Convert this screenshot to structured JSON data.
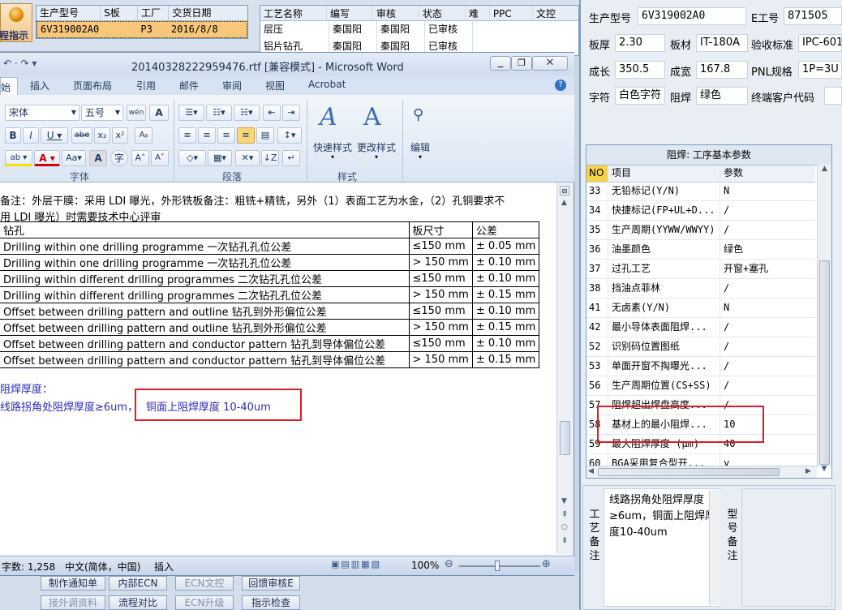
{
  "bg_app": {
    "logo_label": "程指示",
    "order_table": {
      "headers": [
        "生产型号",
        "S板",
        "工厂",
        "交货日期"
      ],
      "row": [
        "6V319002A0",
        "",
        "P3",
        "2016/8/8"
      ]
    },
    "process_table": {
      "headers": [
        "工艺名称",
        "编写",
        "审核",
        "状态",
        "难",
        "PPC",
        "文控"
      ],
      "rows": [
        [
          "层压",
          "秦国阳",
          "秦国阳",
          "已审核"
        ],
        [
          "铝片钻孔",
          "秦国阳",
          "秦国阳",
          "已审核"
        ]
      ]
    },
    "bottom_buttons": [
      "制作通知单",
      "内部ECN",
      "ECN文控",
      "回馈审核E",
      "接外调资料",
      "流程对比",
      "ECN升级",
      "指示检查"
    ]
  },
  "right_panel": {
    "fields": {
      "model_label": "生产型号",
      "model_value": "6V319002A0",
      "e_no_label": "E工号",
      "e_no_value": "871505",
      "thickness_label": "板厚",
      "thickness_value": "2.30",
      "material_label": "板材",
      "material_value": "IT-180A",
      "standard_label": "验收标准",
      "standard_value": "IPC-601",
      "length_label": "成长",
      "length_value": "350.5",
      "width_label": "成宽",
      "width_value": "167.8",
      "pnl_label": "PNL规格",
      "pnl_value": "1P=3U",
      "legend_label": "字符",
      "legend_value": "白色字符",
      "mask_label": "阻焊",
      "mask_value": "绿色",
      "customer_label": "终端客户代码",
      "customer_value": ""
    },
    "param_panel": {
      "title": "阻焊: 工序基本参数",
      "headers": [
        "NO",
        "项目",
        "参数"
      ],
      "rows": [
        {
          "no": "33",
          "item": "无铅标记(Y/N)",
          "value": "N"
        },
        {
          "no": "34",
          "item": "快捷标记(FP+UL+D...",
          "value": "/"
        },
        {
          "no": "35",
          "item": "生产周期(YYWW/WWYY)",
          "value": "/"
        },
        {
          "no": "36",
          "item": "油墨颜色",
          "value": "绿色"
        },
        {
          "no": "37",
          "item": "过孔工艺",
          "value": "开窗+塞孔"
        },
        {
          "no": "38",
          "item": "挡油点菲林",
          "value": "/"
        },
        {
          "no": "41",
          "item": "无卤素(Y/N)",
          "value": "N"
        },
        {
          "no": "42",
          "item": "最小导体表面阻焊...",
          "value": "/"
        },
        {
          "no": "52",
          "item": "识别码位置图纸",
          "value": "/"
        },
        {
          "no": "53",
          "item": "单面开窗不掏曝光...",
          "value": "/"
        },
        {
          "no": "56",
          "item": "生产周期位置(CS+SS)",
          "value": "/"
        },
        {
          "no": "57",
          "item": "阻焊超出焊盘高度...",
          "value": "/"
        },
        {
          "no": "58",
          "item": "基材上的最小阻焊...",
          "value": "10"
        },
        {
          "no": "59",
          "item": "最大阻焊厚度 (μm)",
          "value": "40"
        },
        {
          "no": "60",
          "item": "BGA采用复合型开...",
          "value": "y"
        }
      ]
    },
    "notes": {
      "process_label": [
        "工",
        "艺",
        "备",
        "注"
      ],
      "process_text": "线路拐角处阻焊厚度≥6um，铜面上阻焊厚度10-40um",
      "model_label": [
        "型",
        "号",
        "备",
        "注"
      ]
    }
  },
  "word": {
    "title": "20140328222959476.rtf [兼容模式] - Microsoft Word",
    "tabs": [
      "始",
      "插入",
      "页面布局",
      "引用",
      "邮件",
      "审阅",
      "视图",
      "Acrobat"
    ],
    "font_name": "宋体",
    "font_size": "五号",
    "group_labels": [
      "字体",
      "段落",
      "样式",
      "编辑"
    ],
    "styles_quick": "快速样式",
    "styles_change": "更改样式",
    "edit_label": "编辑",
    "doc": {
      "line1": "备注：外层干膜：采用 LDI 曝光，外形铣板备注：粗铣+精铣，另外（1）表面工艺为水金，（2）孔铜要求不",
      "line2": "用 LDI 曝光）时需要技术中心评审",
      "table_headers": [
        "钻孔",
        "板尺寸",
        "公差"
      ],
      "table_rows": [
        [
          "Drilling within one drilling programme 一次钻孔孔位公差",
          "≤150 mm",
          "± 0.05 mm"
        ],
        [
          "Drilling within one drilling programme 一次钻孔孔位公差",
          "> 150 mm",
          "± 0.10 mm"
        ],
        [
          "Drilling within different drilling programmes 二次钻孔孔位公差",
          "≤150 mm",
          "± 0.10 mm"
        ],
        [
          "Drilling within different drilling programmes 二次钻孔孔位公差",
          "> 150 mm",
          "± 0.15 mm"
        ],
        [
          "Offset between drilling pattern and outline 钻孔到外形偏位公差",
          "≤150 mm",
          "± 0.10 mm"
        ],
        [
          "Offset between drilling pattern and outline 钻孔到外形偏位公差",
          "> 150 mm",
          "± 0.15 mm"
        ],
        [
          "Offset between drilling pattern and conductor pattern 钻孔到导体偏位公差",
          "≤150 mm",
          "± 0.10 mm"
        ],
        [
          "Offset between drilling pattern and conductor pattern 钻孔到导体偏位公差",
          "> 150 mm",
          "± 0.15 mm"
        ]
      ],
      "mask_heading": "阻焊厚度：",
      "mask_line_a": "线路拐角处阻焊厚度≥6um，",
      "mask_line_b": "铜面上阻焊厚度 10-40um"
    },
    "status": {
      "words": "字数: 1,258",
      "language": "中文(简体，中国)",
      "mode": "插入",
      "zoom": "100%"
    }
  }
}
